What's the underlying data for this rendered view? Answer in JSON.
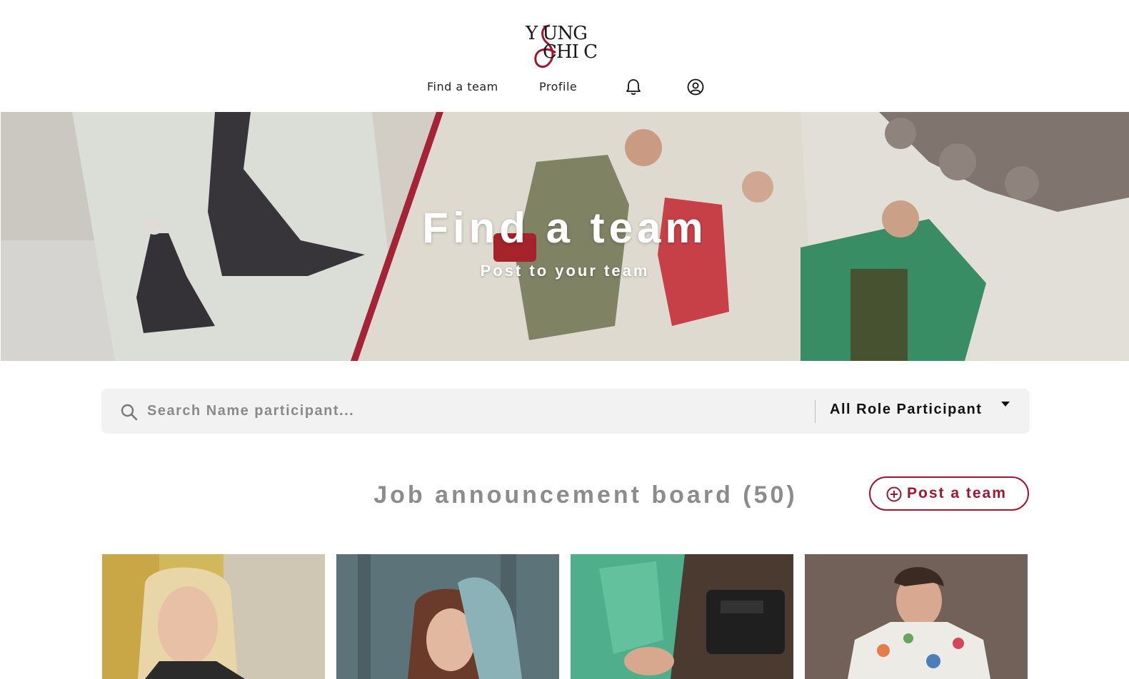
{
  "brand": {
    "logo_line1": "Y UNG",
    "logo_line2": "CHI C",
    "accent_color": "#a3152f"
  },
  "nav": {
    "find_team": "Find a team",
    "profile": "Profile",
    "icons": [
      "bell-icon",
      "user-circle-icon"
    ]
  },
  "hero": {
    "title": "Find a team",
    "subtitle": "Post to your team"
  },
  "search": {
    "placeholder": "Search Name participant...",
    "value": "",
    "role_selected": "All Role Participant"
  },
  "board": {
    "title": "Job announcement board (50)",
    "post_button": "Post a team"
  },
  "cards": [
    {
      "photo": "blonde-woman-portrait"
    },
    {
      "photo": "woman-in-forest"
    },
    {
      "photo": "sewing-machine-fabric"
    },
    {
      "photo": "man-floral-shirt"
    }
  ]
}
